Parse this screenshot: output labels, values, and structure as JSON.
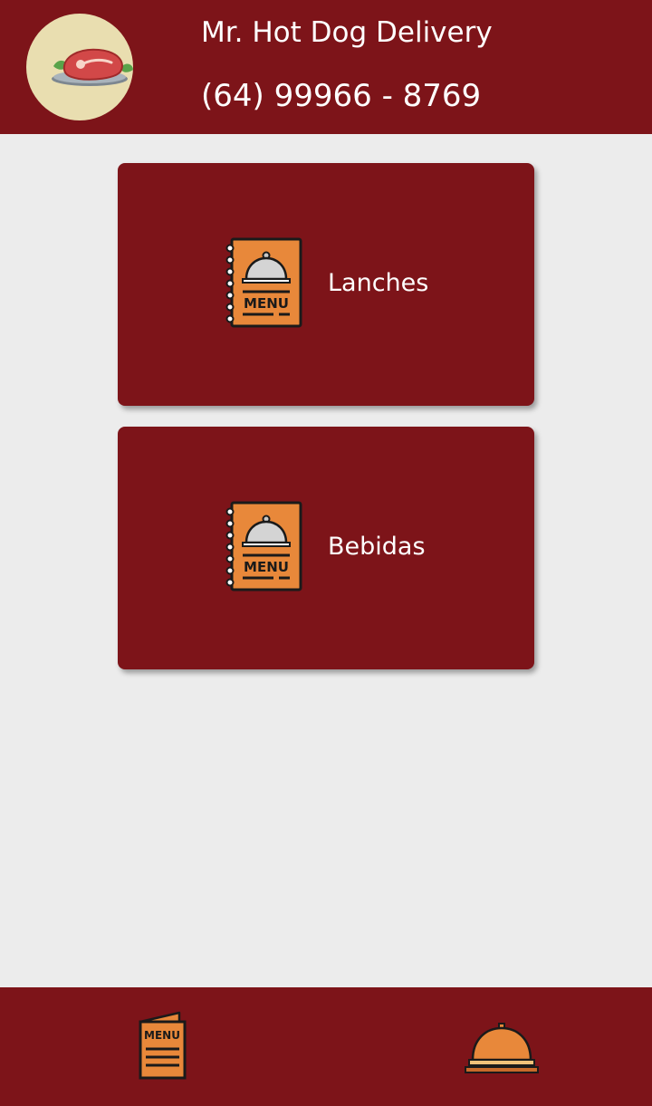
{
  "header": {
    "logo_icon": "meat-plate-icon",
    "title": "Mr. Hot Dog Delivery",
    "phone": "(64) 99966 - 8769"
  },
  "categories": [
    {
      "label": "Lanches",
      "icon": "menu-book-icon",
      "icon_text": "MENU"
    },
    {
      "label": "Bebidas",
      "icon": "menu-book-icon",
      "icon_text": "MENU"
    }
  ],
  "bottom_nav": {
    "menu_icon": "menu-icon",
    "menu_icon_text": "MENU",
    "order_icon": "service-bell-icon"
  },
  "colors": {
    "primary": "#7d1419",
    "background": "#ececec",
    "accent": "#e8883a",
    "logo_bg": "#e9deb0"
  }
}
